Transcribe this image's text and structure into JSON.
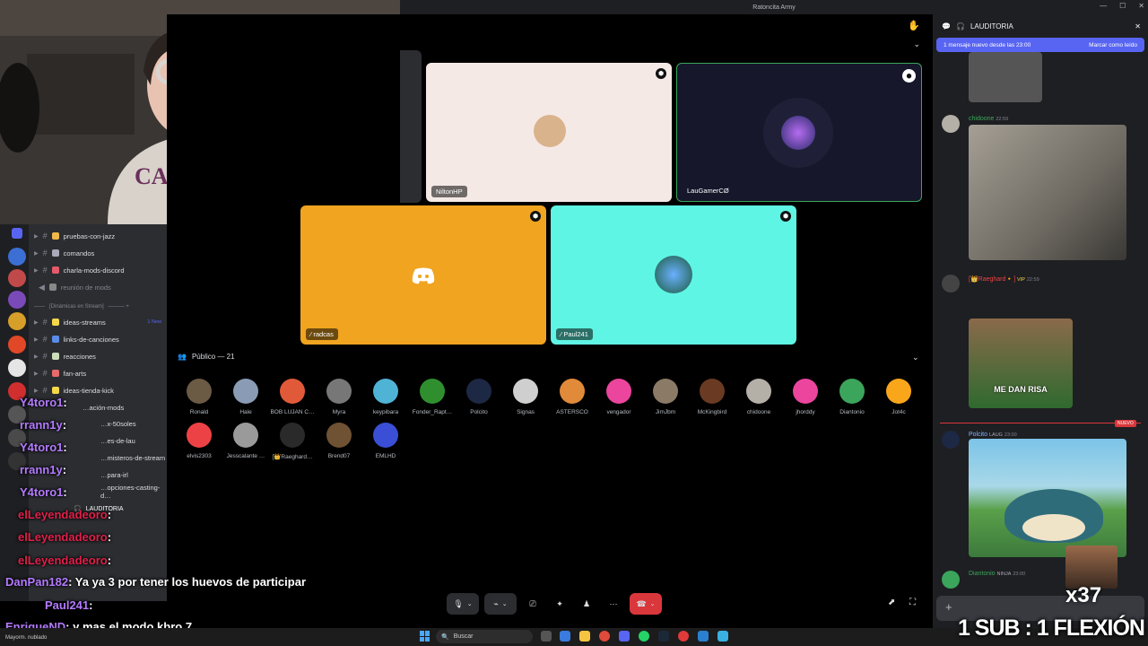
{
  "window": {
    "title": "Ratoncita Army"
  },
  "channels": [
    {
      "icon": "cat",
      "label": "pruebas-con-jazz"
    },
    {
      "icon": "",
      "label": "comandos"
    },
    {
      "icon": "megaphone",
      "label": "charla-mods-discord"
    },
    {
      "icon": "clock",
      "label": "reunión de mods"
    },
    {
      "icon": "",
      "label": "[Dinámicas en Stream]"
    },
    {
      "icon": "bulb",
      "label": "ideas-streams",
      "badge": "1 New"
    },
    {
      "icon": "note",
      "label": "links-de-canciones"
    },
    {
      "icon": "",
      "label": "reacciones"
    },
    {
      "icon": "palette",
      "label": "fan-arts"
    },
    {
      "icon": "bulb",
      "label": "ideas-tienda-kick"
    },
    {
      "icon": "",
      "label": "…ación-mods"
    },
    {
      "icon": "",
      "label": "…x-50soles"
    },
    {
      "icon": "",
      "label": "…es-de-lau"
    },
    {
      "icon": "",
      "label": "…misteros-de-stream"
    },
    {
      "icon": "",
      "label": "…para-irl"
    },
    {
      "icon": "",
      "label": "…opciones-casting-d…"
    },
    {
      "icon": "headset",
      "label": "LAUDITORIA"
    }
  ],
  "stage": {
    "tiles": [
      {
        "label": "NiltonHP",
        "bg": "#f5e9e6"
      },
      {
        "label": "LauGamerCØ",
        "bg": "#16172b"
      },
      {
        "label": "radcas",
        "bg": "#f0a420"
      },
      {
        "label": "Paul241",
        "bg": "#5ff5e4"
      }
    ],
    "audience_title": "Público — 21",
    "audience": [
      {
        "name": "Ronald",
        "color": "#6b5a44"
      },
      {
        "name": "Hale",
        "color": "#8a9bb5"
      },
      {
        "name": "BOB LUJAN C…",
        "color": "#e05a3a"
      },
      {
        "name": "Myra",
        "color": "#777"
      },
      {
        "name": "keypibara",
        "color": "#4fb3d6"
      },
      {
        "name": "Fonder_Rapt…",
        "color": "#2f8f2f"
      },
      {
        "name": "Polcito",
        "color": "#1d2844"
      },
      {
        "name": "Signas",
        "color": "#cfcfcf"
      },
      {
        "name": "ASTERSCO",
        "color": "#e08a3a"
      },
      {
        "name": "vengador",
        "color": "#eb459e"
      },
      {
        "name": "JimJbm",
        "color": "#8a7a66"
      },
      {
        "name": "McKingbird",
        "color": "#6a3a22"
      },
      {
        "name": "chidoone",
        "color": "#b4b0a8"
      },
      {
        "name": "jhorddy",
        "color": "#eb459e"
      },
      {
        "name": "Diantonio",
        "color": "#3ba55c"
      },
      {
        "name": "Jot4c",
        "color": "#faa61a"
      },
      {
        "name": "elvis2303",
        "color": "#ed4245"
      },
      {
        "name": "Jesscalante …",
        "color": "#9a9a9a"
      },
      {
        "name": "[👑Raeghard…",
        "color": "#2a2a2a"
      },
      {
        "name": "Brend07",
        "color": "#6e5233"
      },
      {
        "name": "EMLHD",
        "color": "#3a4fd6"
      }
    ]
  },
  "controls": [
    "🎤",
    "⌄",
    "⌁",
    "⌄",
    "⎚",
    "✦",
    "♟",
    "⋯",
    "☎",
    "⌄"
  ],
  "right_panel": {
    "header": "LAUDITORIA",
    "new_messages": "1 mensaje nuevo desde las 23:00",
    "mark_read": "Marcar como leído",
    "messages": [
      {
        "user": "chidoone",
        "time": "22:59"
      },
      {
        "user": "[👑Raeghard🔸]",
        "badge": "VIP",
        "time": "22:59"
      },
      {
        "caption": "ME DAN RISA"
      },
      {
        "user": "Polcito",
        "badge": "LAUG",
        "time": "23:00",
        "new": "NUEVO"
      },
      {
        "user": "Diantonio",
        "badge": "NINJA",
        "time": "23:00"
      }
    ]
  },
  "twitch_chat": [
    {
      "user": "Y4toro1",
      "text": ":"
    },
    {
      "user": "rrann1y",
      "text": ":"
    },
    {
      "user": "Y4toro1",
      "text": ":"
    },
    {
      "user": "rrann1y",
      "text": ":"
    },
    {
      "user": "Y4toro1",
      "text": ":"
    },
    {
      "user": "elLeyendadeoro",
      "text": ":"
    },
    {
      "user": "elLeyendadeoro",
      "text": ":"
    },
    {
      "user": "elLeyendadeoro",
      "text": ":"
    },
    {
      "user": "DanPan182",
      "text": ": Ya ya 3 por tener los huevos de participar"
    },
    {
      "user": "Paul241",
      "text": ":"
    },
    {
      "user": "EnriqueND",
      "text": ": y mas el modo kbro 7"
    }
  ],
  "overlay": {
    "counter": "x37",
    "sub_text": "1 SUB : 1 FLEXIÓN"
  },
  "taskbar": {
    "search": "Buscar",
    "weather": "Mayorm. nublado"
  }
}
